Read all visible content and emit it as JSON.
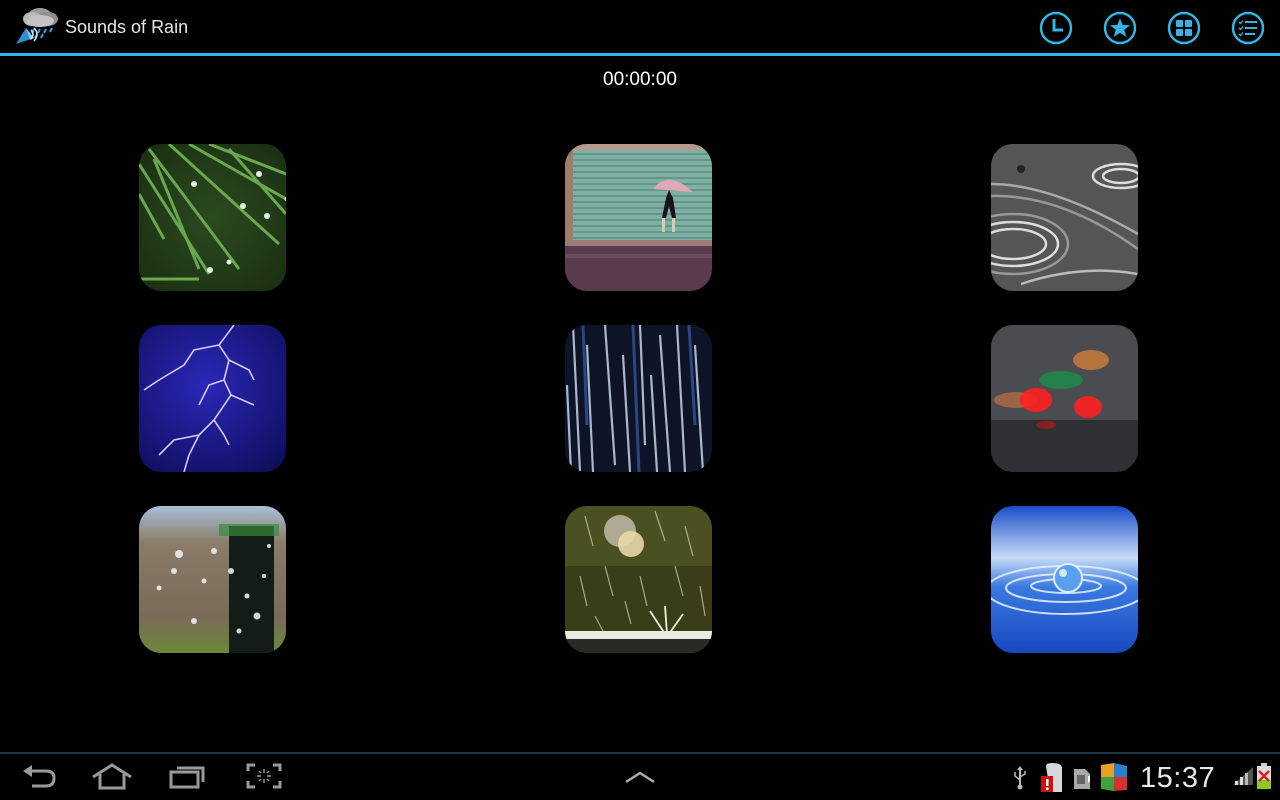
{
  "app": {
    "title": "Sounds of Rain",
    "accent_color": "#33b5e5"
  },
  "actionbar": {
    "buttons": [
      {
        "name": "timer-button",
        "icon": "clock-icon"
      },
      {
        "name": "favorites-button",
        "icon": "star-icon"
      },
      {
        "name": "grid-view-button",
        "icon": "grid-icon"
      },
      {
        "name": "playlist-button",
        "icon": "checklist-icon"
      }
    ]
  },
  "timer": {
    "value": "00:00:00"
  },
  "sounds": {
    "tiles": [
      {
        "name": "pine-needles-drops",
        "subject": "rain drops on pine needles"
      },
      {
        "name": "umbrella-walker",
        "subject": "person with umbrella in rain"
      },
      {
        "name": "puddle-ripples",
        "subject": "ripples in puddle"
      },
      {
        "name": "thunderstorm-lightning",
        "subject": "lightning storm"
      },
      {
        "name": "heavy-downpour",
        "subject": "heavy rain streaks"
      },
      {
        "name": "rain-on-windshield",
        "subject": "blurred traffic lights through wet glass"
      },
      {
        "name": "window-drops",
        "subject": "rain drops on window"
      },
      {
        "name": "garden-rain",
        "subject": "rain splashing in garden"
      },
      {
        "name": "water-drop",
        "subject": "water droplet splash"
      }
    ]
  },
  "navbar": {
    "buttons": [
      {
        "name": "back-button",
        "icon": "back-icon"
      },
      {
        "name": "home-button",
        "icon": "home-icon"
      },
      {
        "name": "recent-apps-button",
        "icon": "recent-apps-icon"
      },
      {
        "name": "screenshot-button",
        "icon": "screenshot-icon"
      },
      {
        "name": "expand-button",
        "icon": "chevron-up-icon"
      }
    ],
    "status": {
      "time": "15:37",
      "icons": [
        "usb-icon",
        "sd-card-error-icon",
        "sim-card-icon",
        "avg-antivirus-icon",
        "signal-icon",
        "battery-error-icon"
      ]
    }
  }
}
